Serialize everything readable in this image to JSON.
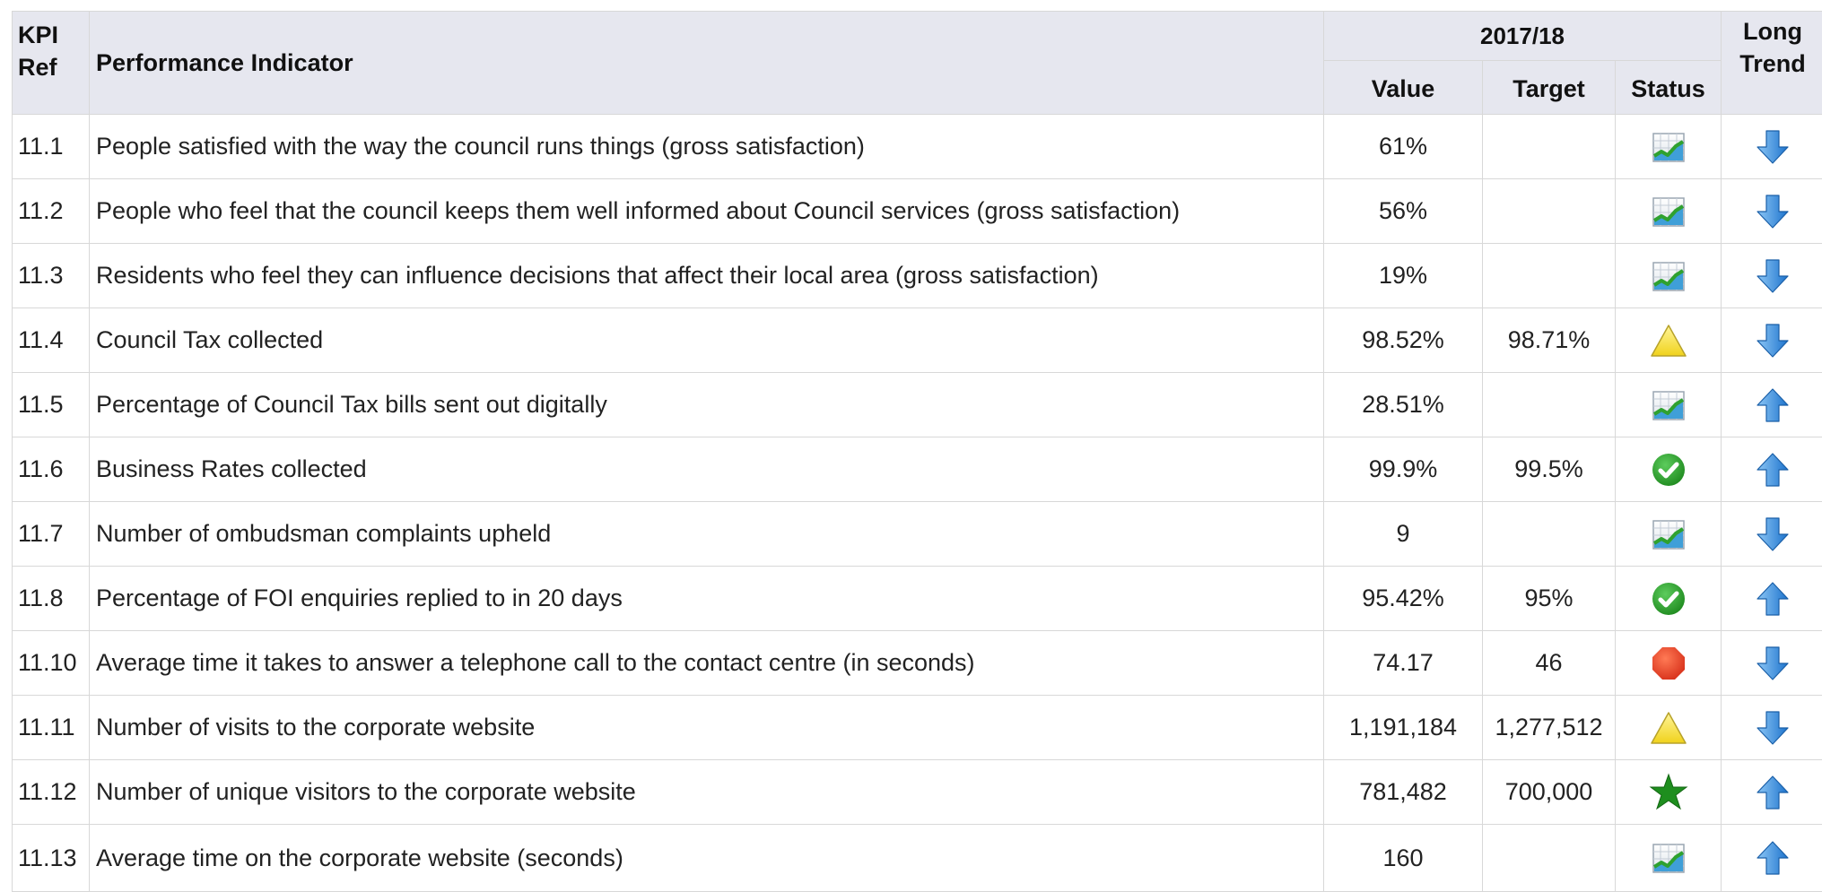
{
  "header": {
    "kpi_ref_line1": "KPI",
    "kpi_ref_line2": "Ref",
    "indicator": "Performance Indicator",
    "period": "2017/18",
    "value": "Value",
    "target": "Target",
    "status": "Status",
    "trend_line1": "Long",
    "trend_line2": "Trend"
  },
  "colors": {
    "header_bg": "#e6e7ef",
    "border": "#d8d8d8",
    "arrow_blue": "#2f8be0",
    "ok_green": "#2e9e2e",
    "alert_red": "#e8412a",
    "warn_yellow": "#f2dc2a"
  },
  "rows": [
    {
      "ref": "11.1",
      "indicator": "People satisfied with the way the council runs things (gross satisfaction)",
      "value": "61%",
      "target": "",
      "status_icon": "data-only-chart-icon",
      "trend_icon": "arrow-down-icon"
    },
    {
      "ref": "11.2",
      "indicator": "People who feel that the council keeps them well informed about Council services (gross satisfaction)",
      "value": "56%",
      "target": "",
      "status_icon": "data-only-chart-icon",
      "trend_icon": "arrow-down-icon"
    },
    {
      "ref": "11.3",
      "indicator": "Residents who feel they can influence decisions that affect their local area (gross satisfaction)",
      "value": "19%",
      "target": "",
      "status_icon": "data-only-chart-icon",
      "trend_icon": "arrow-down-icon"
    },
    {
      "ref": "11.4",
      "indicator": "Council Tax collected",
      "value": "98.52%",
      "target": "98.71%",
      "status_icon": "warning-triangle-icon",
      "trend_icon": "arrow-down-icon"
    },
    {
      "ref": "11.5",
      "indicator": "Percentage of Council Tax bills sent out digitally",
      "value": "28.51%",
      "target": "",
      "status_icon": "data-only-chart-icon",
      "trend_icon": "arrow-up-icon"
    },
    {
      "ref": "11.6",
      "indicator": "Business Rates collected",
      "value": "99.9%",
      "target": "99.5%",
      "status_icon": "ok-check-icon",
      "trend_icon": "arrow-up-icon"
    },
    {
      "ref": "11.7",
      "indicator": "Number of ombudsman complaints upheld",
      "value": "9",
      "target": "",
      "status_icon": "data-only-chart-icon",
      "trend_icon": "arrow-down-icon"
    },
    {
      "ref": "11.8",
      "indicator": "Percentage of FOI enquiries replied to in 20 days",
      "value": "95.42%",
      "target": "95%",
      "status_icon": "ok-check-icon",
      "trend_icon": "arrow-up-icon"
    },
    {
      "ref": "11.10",
      "indicator": "Average time it takes to answer a telephone call to the contact centre (in seconds)",
      "value": "74.17",
      "target": "46",
      "status_icon": "alert-stop-icon",
      "trend_icon": "arrow-down-icon"
    },
    {
      "ref": "11.11",
      "indicator": "Number of visits to the corporate website",
      "value": "1,191,184",
      "target": "1,277,512",
      "status_icon": "warning-triangle-icon",
      "trend_icon": "arrow-down-icon"
    },
    {
      "ref": "11.12",
      "indicator": "Number of unique visitors to the corporate website",
      "value": "781,482",
      "target": "700,000",
      "status_icon": "star-icon",
      "trend_icon": "arrow-up-icon"
    },
    {
      "ref": "11.13",
      "indicator": "Average time on the corporate website (seconds)",
      "value": "160",
      "target": "",
      "status_icon": "data-only-chart-icon",
      "trend_icon": "arrow-up-icon"
    }
  ]
}
